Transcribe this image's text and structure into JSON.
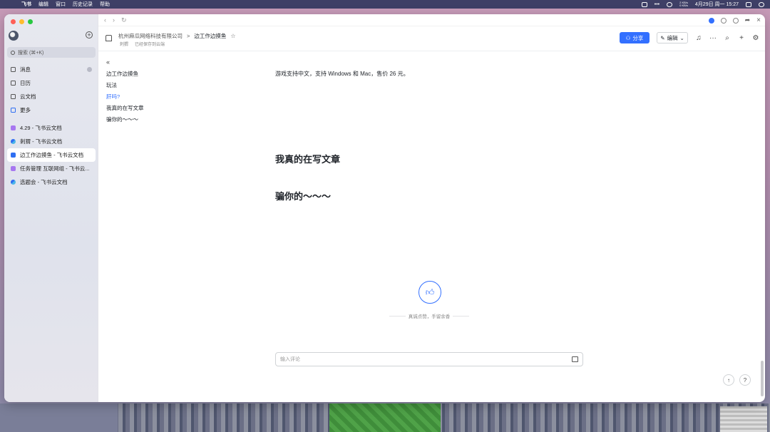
{
  "menubar": {
    "app": "飞书",
    "items": [
      "编辑",
      "窗口",
      "历史记录",
      "帮助"
    ],
    "net_up": "2 KB/s",
    "net_down": "0 KB/s",
    "datetime": "4月29日 周一 15:27"
  },
  "sidebar": {
    "search_placeholder": "搜索 (⌘+K)",
    "nav": [
      {
        "label": "消息",
        "icon": "chat-icon"
      },
      {
        "label": "日历",
        "icon": "calendar-icon"
      },
      {
        "label": "云文档",
        "icon": "cloud-doc-icon"
      },
      {
        "label": "更多",
        "icon": "grid-icon"
      }
    ],
    "docs": [
      {
        "label": "4.29 - 飞书云文档",
        "type": "purple"
      },
      {
        "label": "刺猬 - 飞书云文档",
        "type": "mind"
      },
      {
        "label": "边工作边摸鱼 - 飞书云文档",
        "type": "blue"
      },
      {
        "label": "任务管理 互联网组 - 飞书云...",
        "type": "purple"
      },
      {
        "label": "选题会 - 飞书云文档",
        "type": "mind"
      }
    ]
  },
  "header": {
    "breadcrumb_parent": "杭州麻瓜网络科技有限公司",
    "breadcrumb_sep": ">",
    "breadcrumb_current": "边工作边摸鱼",
    "meta_author": "刺猬",
    "meta_status": "已经保存到云端",
    "share_label": "分享",
    "edit_label": "编辑"
  },
  "toc": {
    "items": [
      "边工作边摸鱼",
      "玩法",
      "肝吗?",
      "我真的在写文章",
      "骗你的～～～"
    ],
    "active_index": 2
  },
  "content": {
    "paragraph": "游戏支持中文，支持 Windows 和 Mac，售价 26 元。",
    "heading1": "我真的在写文章",
    "heading2": "骗你的～～～"
  },
  "footer": {
    "like_text": "真诚点赞，手留余香",
    "comment_placeholder": "输入评论"
  }
}
